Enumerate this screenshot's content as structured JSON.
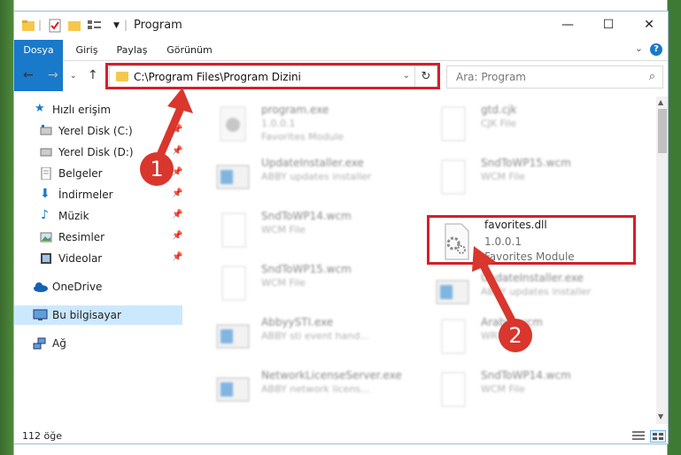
{
  "window": {
    "title": "Program",
    "controls": {
      "minimize": "—",
      "maximize": "☐",
      "close": "✕"
    }
  },
  "ribbon": {
    "tabs": [
      "Dosya",
      "Giriş",
      "Paylaş",
      "Görünüm"
    ],
    "help": "?"
  },
  "nav": {
    "address": "C:\\Program Files\\Program Dizini",
    "search_placeholder": "Ara: Program"
  },
  "sidebar": {
    "items": [
      {
        "label": "Hızlı erişim",
        "icon": "star-icon",
        "pinned": false
      },
      {
        "label": "Yerel Disk (C:)",
        "icon": "drive-icon",
        "pinned": true
      },
      {
        "label": "Yerel Disk (D:)",
        "icon": "drive-icon",
        "pinned": true
      },
      {
        "label": "Belgeler",
        "icon": "documents-icon",
        "pinned": true
      },
      {
        "label": "İndirmeler",
        "icon": "download-icon",
        "pinned": true
      },
      {
        "label": "Müzik",
        "icon": "music-icon",
        "pinned": true
      },
      {
        "label": "Resimler",
        "icon": "pictures-icon",
        "pinned": true
      },
      {
        "label": "Videolar",
        "icon": "video-icon",
        "pinned": true
      },
      {
        "label": "OneDrive",
        "icon": "cloud-icon",
        "pinned": false
      },
      {
        "label": "Bu bilgisayar",
        "icon": "computer-icon",
        "pinned": false,
        "selected": true
      },
      {
        "label": "Ağ",
        "icon": "network-icon",
        "pinned": false
      }
    ]
  },
  "files": [
    {
      "name": "program.exe",
      "line1": "1.0.0.1",
      "line2": "Favorites Module",
      "icon": "gear-file-icon"
    },
    {
      "name": "gtd.cjk",
      "line1": "CJK File",
      "line2": "",
      "icon": "blank-file-icon"
    },
    {
      "name": "UpdateInstaller.exe",
      "line1": "ABBY updates installer",
      "line2": "",
      "icon": "window-app-icon"
    },
    {
      "name": "SndToWP15.wcm",
      "line1": "WCM File",
      "line2": "",
      "icon": "blank-file-icon"
    },
    {
      "name": "SndToWP14.wcm",
      "line1": "WCM File",
      "line2": "",
      "icon": "blank-file-icon"
    },
    {
      "name": "favorites.dll",
      "line1": "1.0.0.1",
      "line2": "Favorites Module",
      "icon": "dll-gear-icon",
      "highlighted": true
    },
    {
      "name": "SndToWP15.wcm",
      "line1": "WCM File",
      "line2": "",
      "icon": "blank-file-icon"
    },
    {
      "name": "UpdateInstaller.exe",
      "line1": "ABBY updates installer",
      "line2": "",
      "icon": "window-app-icon"
    },
    {
      "name": "AbbyySTI.exe",
      "line1": "ABBY sti event hand...",
      "line2": "",
      "icon": "window-app-icon"
    },
    {
      "name": "Arabic.wcm",
      "line1": "WRD File",
      "line2": "",
      "icon": "blank-file-icon"
    },
    {
      "name": "NetworkLicenseServer.exe",
      "line1": "ABBY network licens...",
      "line2": "",
      "icon": "window-app-icon"
    },
    {
      "name": "SndToWP14.wcm",
      "line1": "WCM File",
      "line2": "",
      "icon": "blank-file-icon"
    }
  ],
  "status": {
    "count": "112 öğe"
  },
  "annotations": {
    "badge1": "1",
    "badge2": "2",
    "color": "#d9362d"
  }
}
